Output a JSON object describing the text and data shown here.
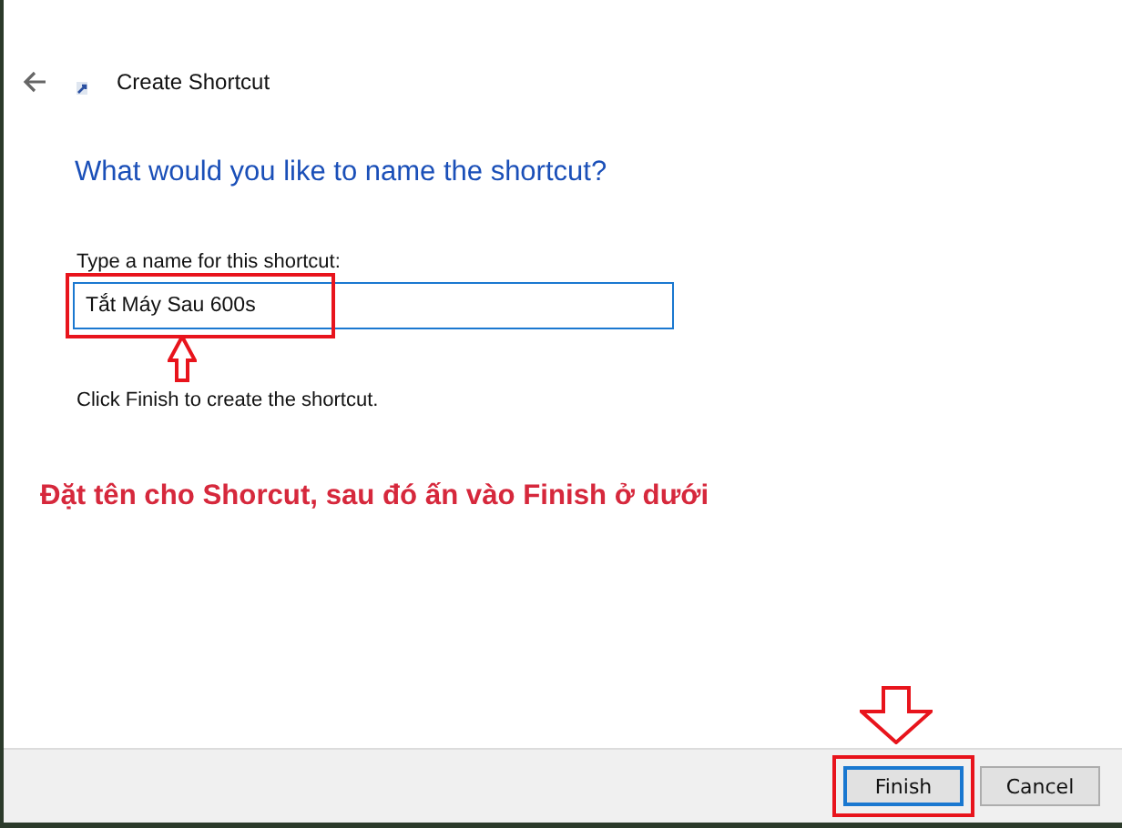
{
  "dialog": {
    "title": "Create Shortcut",
    "heading": "What would you like to name the shortcut?",
    "name_field": {
      "label": "Type a name for this shortcut:",
      "value": "Tắt Máy Sau 600s"
    },
    "hint": "Click Finish to create the shortcut.",
    "buttons": [
      {
        "label": "Finish",
        "focused": true
      },
      {
        "label": "Cancel",
        "focused": false
      }
    ]
  },
  "annotation": {
    "caption": "Đặt tên cho Shorcut, sau đó ấn vào Finish ở dưới"
  }
}
